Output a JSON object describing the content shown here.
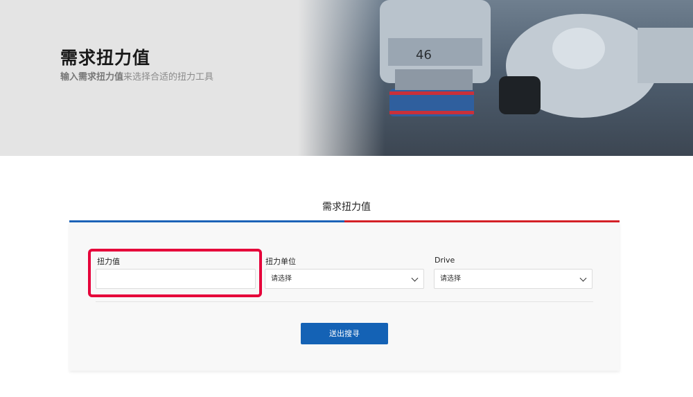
{
  "hero": {
    "title": "需求扭力值",
    "subtitle_bold": "输入需求扭力值",
    "subtitle_rest": "来选择合适的扭力工具",
    "socket_marking": "46"
  },
  "form": {
    "section_title": "需求扭力值",
    "torque_value": {
      "label": "扭力值",
      "value": "",
      "placeholder": ""
    },
    "torque_unit": {
      "label": "扭力单位",
      "selected": "请选择"
    },
    "drive": {
      "label": "Drive",
      "selected": "请选择"
    },
    "submit_label": "送出搜寻"
  },
  "colors": {
    "tab_blue": "#1c63b8",
    "tab_red": "#d42027",
    "button": "#1462b5",
    "highlight": "#e6003a"
  }
}
